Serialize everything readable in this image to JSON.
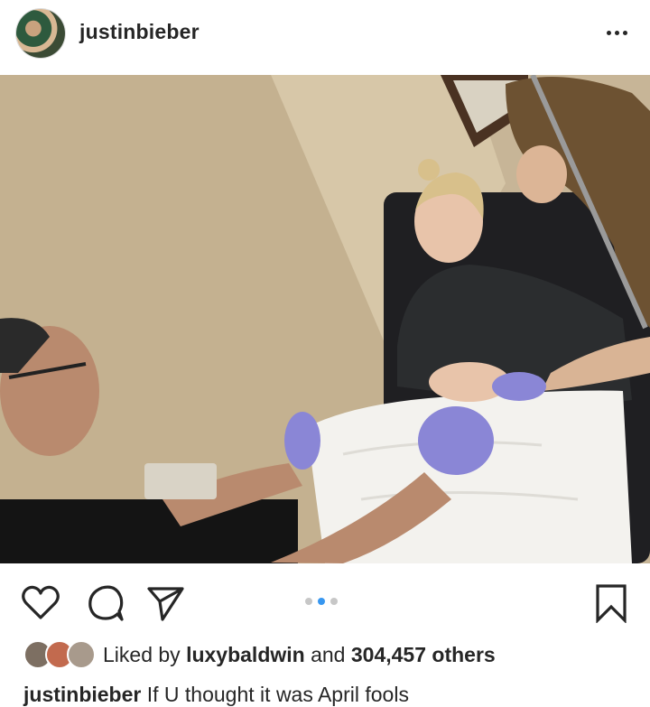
{
  "post": {
    "username": "justinbieber",
    "more_icon": "more-horizontal-icon"
  },
  "carousel": {
    "count": 3,
    "active_index": 1
  },
  "actions": {
    "like_icon": "heart-icon",
    "comment_icon": "comment-icon",
    "share_icon": "send-icon",
    "save_icon": "bookmark-icon"
  },
  "likes": {
    "prefix": "Liked by ",
    "user": "luxybaldwin",
    "middle": " and ",
    "count": "304,457 others"
  },
  "caption": {
    "username": "justinbieber",
    "text": " If U thought it was April fools"
  },
  "colors": {
    "text": "#262626",
    "accent": "#3897f0",
    "dot_inactive": "#c7c7c7"
  }
}
